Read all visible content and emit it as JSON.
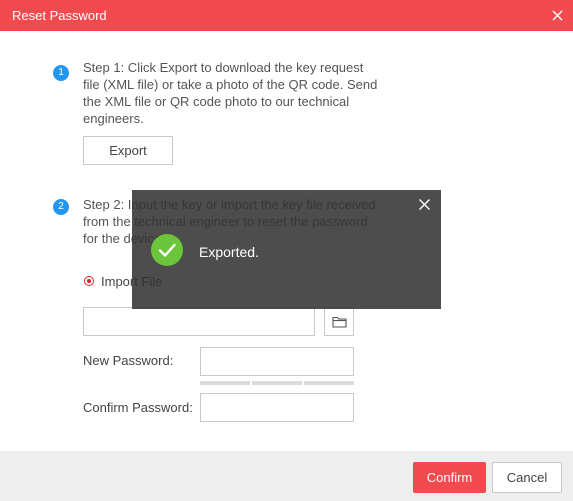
{
  "dialog": {
    "title": "Reset Password",
    "close_icon": "close-icon"
  },
  "step1": {
    "number": "1",
    "lines": [
      "Step 1: Click Export to download the key request",
      "file (XML file) or take a photo of the QR code. Send",
      "the XML file or QR code photo to our technical",
      "engineers."
    ],
    "export_label": "Export"
  },
  "step2": {
    "number": "2",
    "lines": [
      "Step 2: Input the key or import the key file received",
      "from the technical engineer to reset the password",
      "for the device."
    ],
    "import_option": "Import File",
    "import_selected": true,
    "file_path_value": "",
    "folder_icon": "folder-icon"
  },
  "passwords": {
    "new_label": "New Password:",
    "new_value": "",
    "confirm_label": "Confirm Password:",
    "confirm_value": "",
    "strength_level": 0
  },
  "footer": {
    "confirm_label": "Confirm",
    "cancel_label": "Cancel"
  },
  "toast": {
    "message": "Exported.",
    "icon": "checkmark-icon",
    "close_icon": "close-icon"
  },
  "colors": {
    "accent": "#f34a50",
    "step_badge": "#2196f3",
    "success": "#6cc53a",
    "radio": "#d7262c"
  }
}
